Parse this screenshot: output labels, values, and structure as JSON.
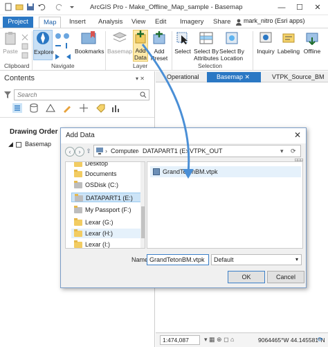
{
  "title_bar": {
    "title": "ArcGIS Pro - Make_Offline_Map_sample - Basemap",
    "minimize": "—",
    "maximize": "☐",
    "close": "✕"
  },
  "tabs": [
    "Project",
    "Map",
    "Insert",
    "Analysis",
    "View",
    "Edit",
    "Imagery",
    "Share"
  ],
  "user": "mark_nitro (Esri apps)",
  "ribbon": {
    "paste": "Paste",
    "explore": "Explore",
    "bookmarks": "Bookmarks",
    "basemap": "Basemap",
    "add_data": "Add\nData",
    "add_preset": "Add\nPreset",
    "select": "Select",
    "select_by_attributes": "Select By\nAttributes",
    "select_by_location": "Select By\nLocation",
    "inquiry": "Inquiry",
    "labeling": "Labeling",
    "offline": "Offline",
    "groups": {
      "clipboard": "Clipboard",
      "navigate": "Navigate",
      "layer": "Layer",
      "selection": "Selection"
    }
  },
  "contents": {
    "header": "Contents",
    "search_placeholder": "Search",
    "drawing_order": "Drawing Order",
    "layer": "Basemap"
  },
  "view_tabs": [
    "Operational",
    "Basemap",
    "VTPK_Source_BM"
  ],
  "status_bar": {
    "scale": "1:474,087",
    "coords": "9064465°W 44.145581°N"
  },
  "dialog": {
    "title": "Add Data",
    "path": [
      "Computer",
      "DATAPART1 (E:)",
      "VTPK_OUT"
    ],
    "left_items": [
      "Desktop",
      "Documents",
      "OSDisk (C:)",
      "DATAPART1 (E:)",
      "My Passport (F:)",
      "Lexar (G:)",
      "Lexar (H:)",
      "Lexar (I:)"
    ],
    "selected_item": "DATAPART1 (E:)",
    "file": "GrandTetonBM.vtpk",
    "name_label": "Name",
    "name_value": "GrandTetonBM.vtpk",
    "type_value": "Default",
    "ok": "OK",
    "cancel": "Cancel"
  },
  "colors": {
    "accent": "#2b78c4",
    "selection": "#cce4f7",
    "folder": "#f2cc62",
    "arrow": "#4a8fd6"
  }
}
